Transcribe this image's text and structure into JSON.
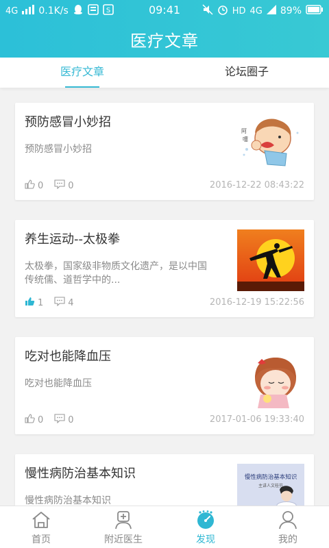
{
  "status_bar": {
    "network": "4G",
    "speed": "0.1K/s",
    "time": "09:41",
    "hd": "HD",
    "net_right": "4G",
    "battery": "89%"
  },
  "header": {
    "title": "医疗文章"
  },
  "tabs": [
    {
      "label": "医疗文章",
      "active": true
    },
    {
      "label": "论坛圈子",
      "active": false
    }
  ],
  "articles": [
    {
      "title": "预防感冒小妙招",
      "desc": "预防感冒小妙招",
      "likes": "0",
      "comments": "0",
      "date": "2016-12-22 08:43:22",
      "liked": false,
      "thumb": "sneezing-cartoon"
    },
    {
      "title": "养生运动--太极拳",
      "desc": "太极拳，国家级非物质文化遗产，是以中国传统儒、道哲学中的...",
      "likes": "1",
      "comments": "4",
      "date": "2016-12-19 15:22:56",
      "liked": true,
      "thumb": "taichi-silhouette-sunset"
    },
    {
      "title": "吃对也能降血压",
      "desc": "吃对也能降血压",
      "likes": "0",
      "comments": "0",
      "date": "2017-01-06 19:33:40",
      "liked": false,
      "thumb": "cartoon-girl"
    },
    {
      "title": "慢性病防治基本知识",
      "desc": "慢性病防治基本知识",
      "likes": "",
      "comments": "",
      "date": "",
      "liked": false,
      "thumb": "chronic-disease-cover"
    }
  ],
  "thumb_text": {
    "cover_title": "慢性病防治基本知识",
    "cover_sub": "主讲人文桂芬"
  },
  "tabbar": [
    {
      "label": "首页",
      "icon": "home-icon",
      "active": false
    },
    {
      "label": "附近医生",
      "icon": "doctor-icon",
      "active": false
    },
    {
      "label": "发现",
      "icon": "discover-icon",
      "active": true
    },
    {
      "label": "我的",
      "icon": "profile-icon",
      "active": false
    }
  ],
  "colors": {
    "accent": "#2fb7d3",
    "header": "#2cc0d8",
    "liked": "#2fb7d3"
  }
}
